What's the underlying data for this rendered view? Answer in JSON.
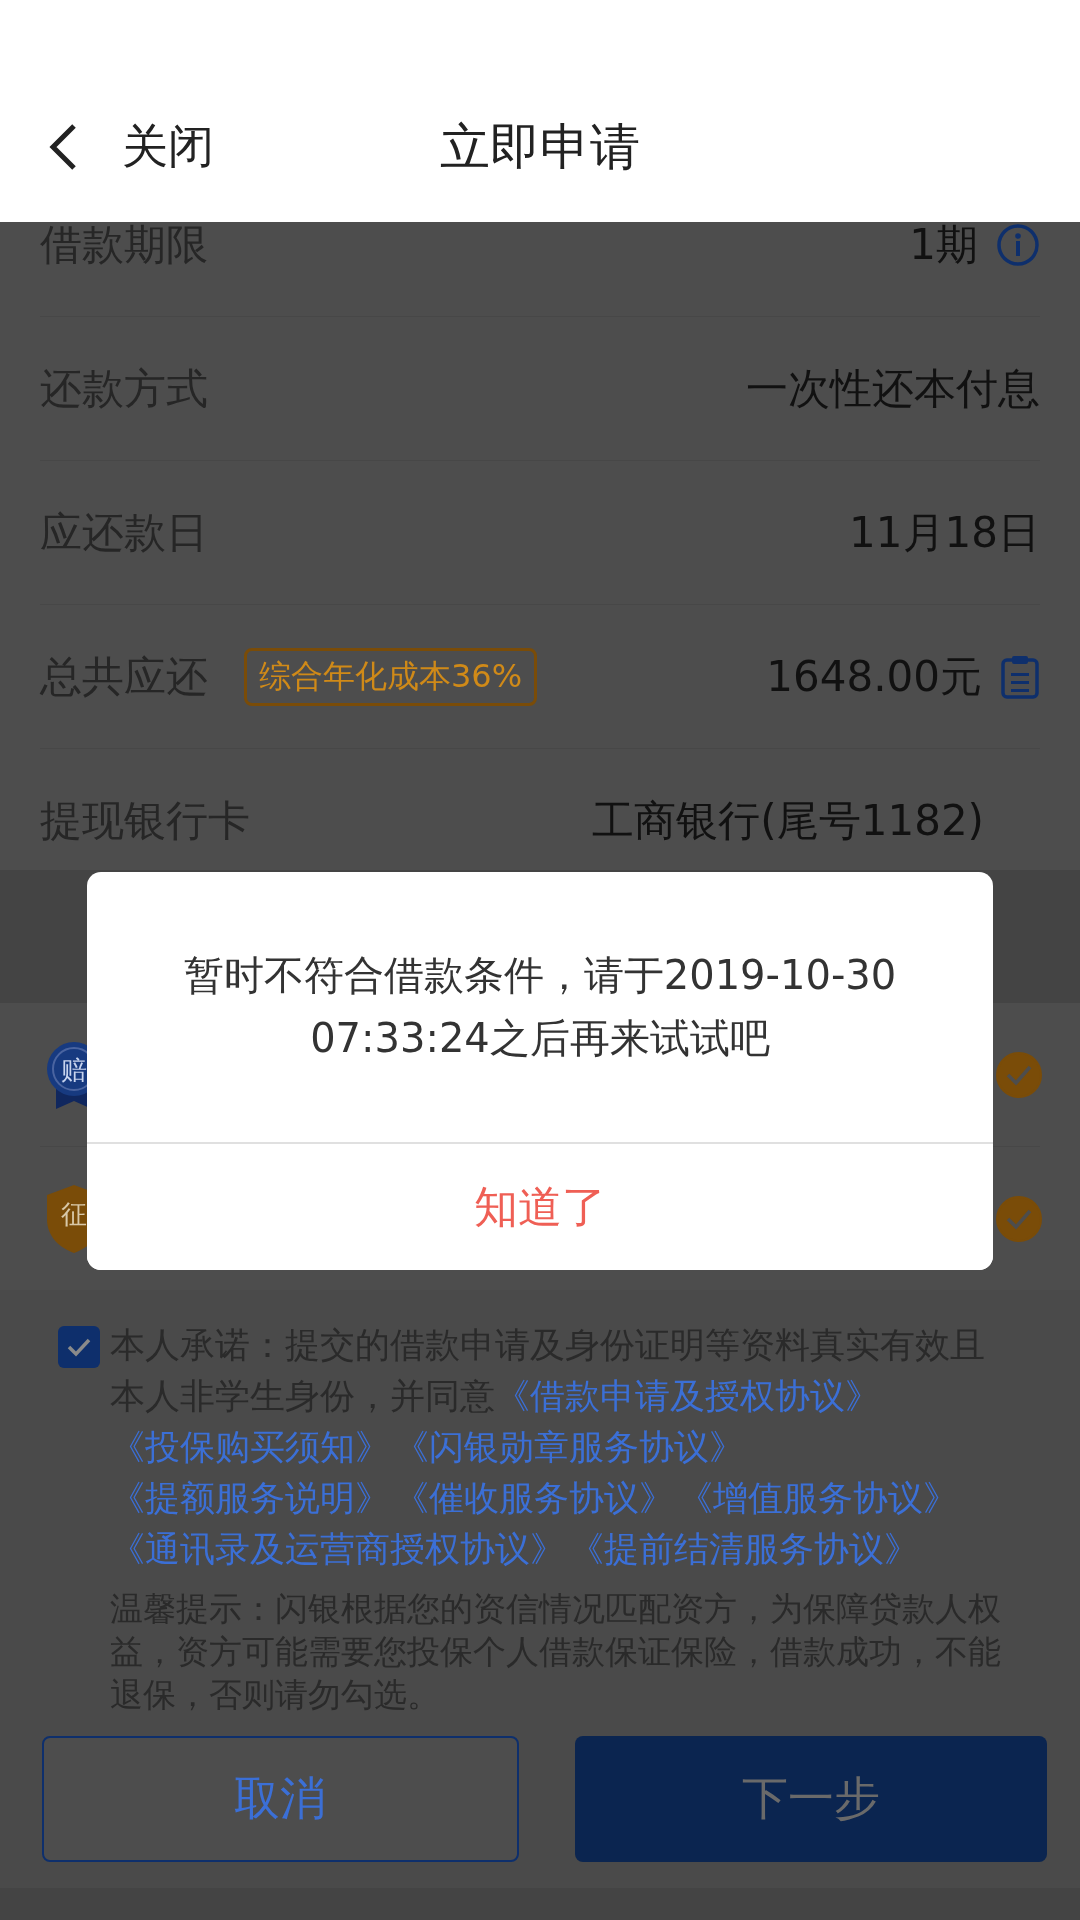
{
  "header": {
    "back_label": "关闭",
    "title": "立即申请"
  },
  "details": [
    {
      "kind": "info",
      "label": "借款期限",
      "value": "1期"
    },
    {
      "kind": "plain",
      "label": "还款方式",
      "value": "一次性还本付息"
    },
    {
      "kind": "plain",
      "label": "应还款日",
      "value": "11月18日"
    },
    {
      "kind": "total",
      "label": "总共应还",
      "badge": "综合年化成本36%",
      "value": "1648.00元"
    },
    {
      "kind": "plain",
      "label": "提现银行卡",
      "value": "工商银行(尾号1182)"
    }
  ],
  "protections": [
    {
      "kind": "medal",
      "icon_text": "赔",
      "checked": true
    },
    {
      "kind": "shield",
      "icon_text": "征",
      "checked": true
    }
  ],
  "agreement": {
    "checked": true,
    "parts": [
      {
        "kind": "text",
        "text": "本人承诺：提交的借款申请及身份证明等资料真实有效且本人非学生身份，并同意"
      },
      {
        "kind": "link",
        "text": "《借款申请及授权协议》"
      },
      {
        "kind": "link",
        "text": "《投保购买须知》"
      },
      {
        "kind": "link",
        "text": "《闪银勋章服务协议》"
      },
      {
        "kind": "link",
        "text": "《提额服务说明》"
      },
      {
        "kind": "link",
        "text": "《催收服务协议》"
      },
      {
        "kind": "link",
        "text": "《增值服务协议》"
      },
      {
        "kind": "link",
        "text": "《通讯录及运营商授权协议》"
      },
      {
        "kind": "link",
        "text": "《提前结清服务协议》"
      }
    ]
  },
  "tip": "温馨提示：闪银根据您的资信情况匹配资方，为保障贷款人权益，资方可能需要您投保个人借款保证保险，借款成功，不能退保，否则请勿勾选。",
  "buttons": [
    {
      "kind": "outline",
      "label": "取消"
    },
    {
      "kind": "primary",
      "label": "下一步"
    }
  ],
  "dialog": {
    "message": "暂时不符合借款条件，请于2019-10-30 07:33:24之后再来试试吧",
    "button": "知道了"
  }
}
